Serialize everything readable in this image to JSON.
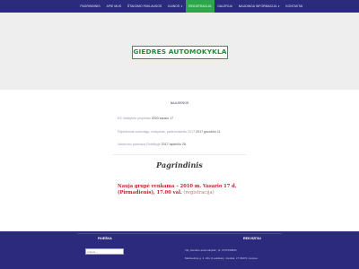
{
  "nav": {
    "items": [
      {
        "label": "PAGRINDINIS",
        "active": false,
        "dropdown": false
      },
      {
        "label": "APIE MUS",
        "active": false,
        "dropdown": false
      },
      {
        "label": "ŠTAIGIMO PAKLAUSOS",
        "active": false,
        "dropdown": false
      },
      {
        "label": "KAINOS",
        "active": false,
        "dropdown": true
      },
      {
        "label": "REGISTRACIJA",
        "active": true,
        "dropdown": false
      },
      {
        "label": "GALERIJA",
        "active": false,
        "dropdown": false
      },
      {
        "label": "NAUDINGA INFORMACIJA",
        "active": false,
        "dropdown": true
      },
      {
        "label": "KONTAKTAI",
        "active": false,
        "dropdown": false
      }
    ],
    "caret": "▾",
    "bg_color": "#2b2a7c",
    "active_color": "#2ca64a"
  },
  "hero": {
    "logo_text": "GIEDRES AUTOMOKYKLA",
    "logo_color": "#1ea33c"
  },
  "news": {
    "title": "NAUJIENOS",
    "items": [
      {
        "muted": "ES Valstybės projektas",
        "date": "2020 sausio 17"
      },
      {
        "muted": "Papildomas autovalgų, mokymas, pademokantis 2017",
        "date": "2017 gruodžio 11"
      },
      {
        "muted": "Vairavimo pamokos Rokiškyje",
        "date": "2017 lapkričio 28"
      }
    ]
  },
  "main": {
    "subheading": "Pagrindinis",
    "announcement_text": "Nauja grupė renkama – 2010 m. Vasario 17 d. (Pirmadienis), 17.00 val.",
    "announcement_link_open": " (",
    "announcement_link": "registracija",
    "announcement_link_close": ")",
    "announcement_color": "#c0232a"
  },
  "footer": {
    "search_title": "PAIEŠKA",
    "search_placeholder": "Ieškoti ...",
    "contacts_title": "REKVIZITAI",
    "contacts_lines": [
      "VšĮ „Giedrės automokykla\", įk. 3747039844",
      "Maršuolinių g. 3, 341 (3 aukštas), Jonikiai, LT 39470, Lietuva"
    ]
  }
}
